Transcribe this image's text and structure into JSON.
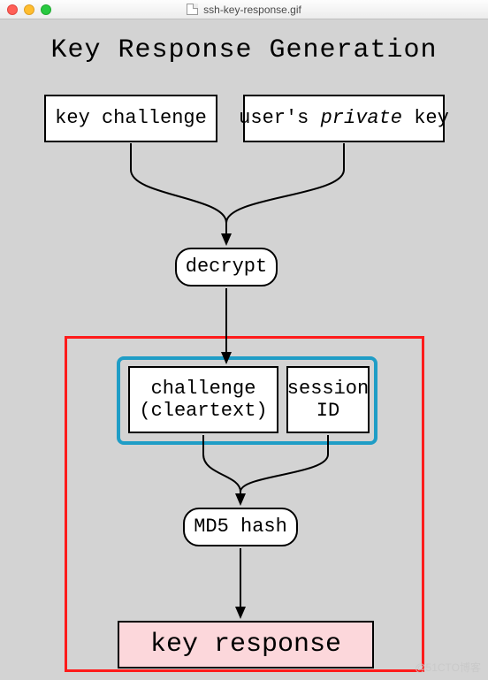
{
  "window": {
    "filename": "ssh-key-response.gif"
  },
  "diagram": {
    "title": "Key Response Generation",
    "nodes": {
      "key_challenge": "key challenge",
      "private_key_pre": "user's ",
      "private_key_em": "private",
      "private_key_post": " key",
      "decrypt": "decrypt",
      "challenge_clear_l1": "challenge",
      "challenge_clear_l2": "(cleartext)",
      "session_id_l1": "session",
      "session_id_l2": "ID",
      "md5": "MD5 hash",
      "key_response": "key response"
    }
  },
  "annotations": {
    "red_box": "hash-stage grouping",
    "blue_box": "hash-inputs grouping"
  },
  "watermark": "@51CTO博客"
}
